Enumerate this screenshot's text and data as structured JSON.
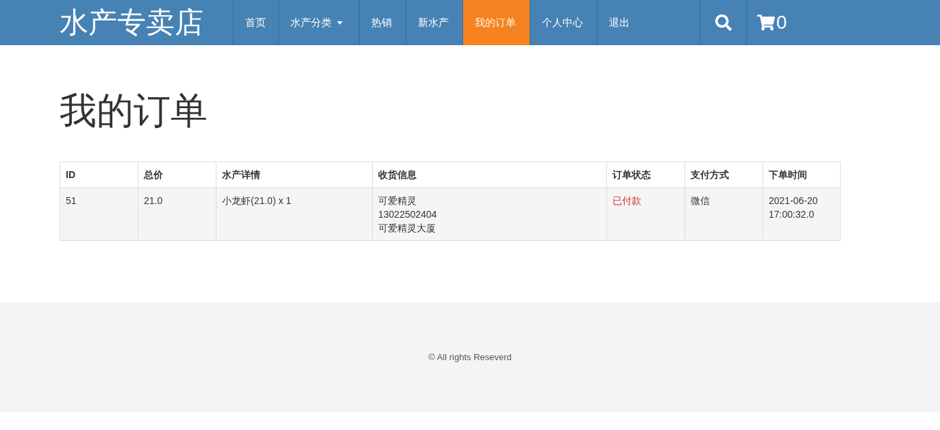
{
  "navbar": {
    "brand": "水产专卖店",
    "items": [
      {
        "label": "首页",
        "selected": false,
        "dropdown": false
      },
      {
        "label": "水产分类",
        "selected": false,
        "dropdown": true
      },
      {
        "label": "热销",
        "selected": false,
        "dropdown": false
      },
      {
        "label": "新水产",
        "selected": false,
        "dropdown": false
      },
      {
        "label": "我的订单",
        "selected": true,
        "dropdown": false
      },
      {
        "label": "个人中心",
        "selected": false,
        "dropdown": false
      },
      {
        "label": "退出",
        "selected": false,
        "dropdown": false
      }
    ],
    "cart_count": "0"
  },
  "page_title": "我的订单",
  "table": {
    "columns": [
      "ID",
      "总价",
      "水产详情",
      "收货信息",
      "订单状态",
      "支付方式",
      "下单时间"
    ],
    "rows": [
      {
        "id": "51",
        "total": "21.0",
        "details": "小龙虾(21.0) x 1",
        "shipping": [
          "可爱精灵",
          "13022502404",
          "可爱精灵大厦"
        ],
        "status": "已付款",
        "paid": true,
        "payment": "微信",
        "time": "2021-06-20 17:00:32.0"
      }
    ]
  },
  "footer": {
    "text": "© All rights Reseverd"
  }
}
